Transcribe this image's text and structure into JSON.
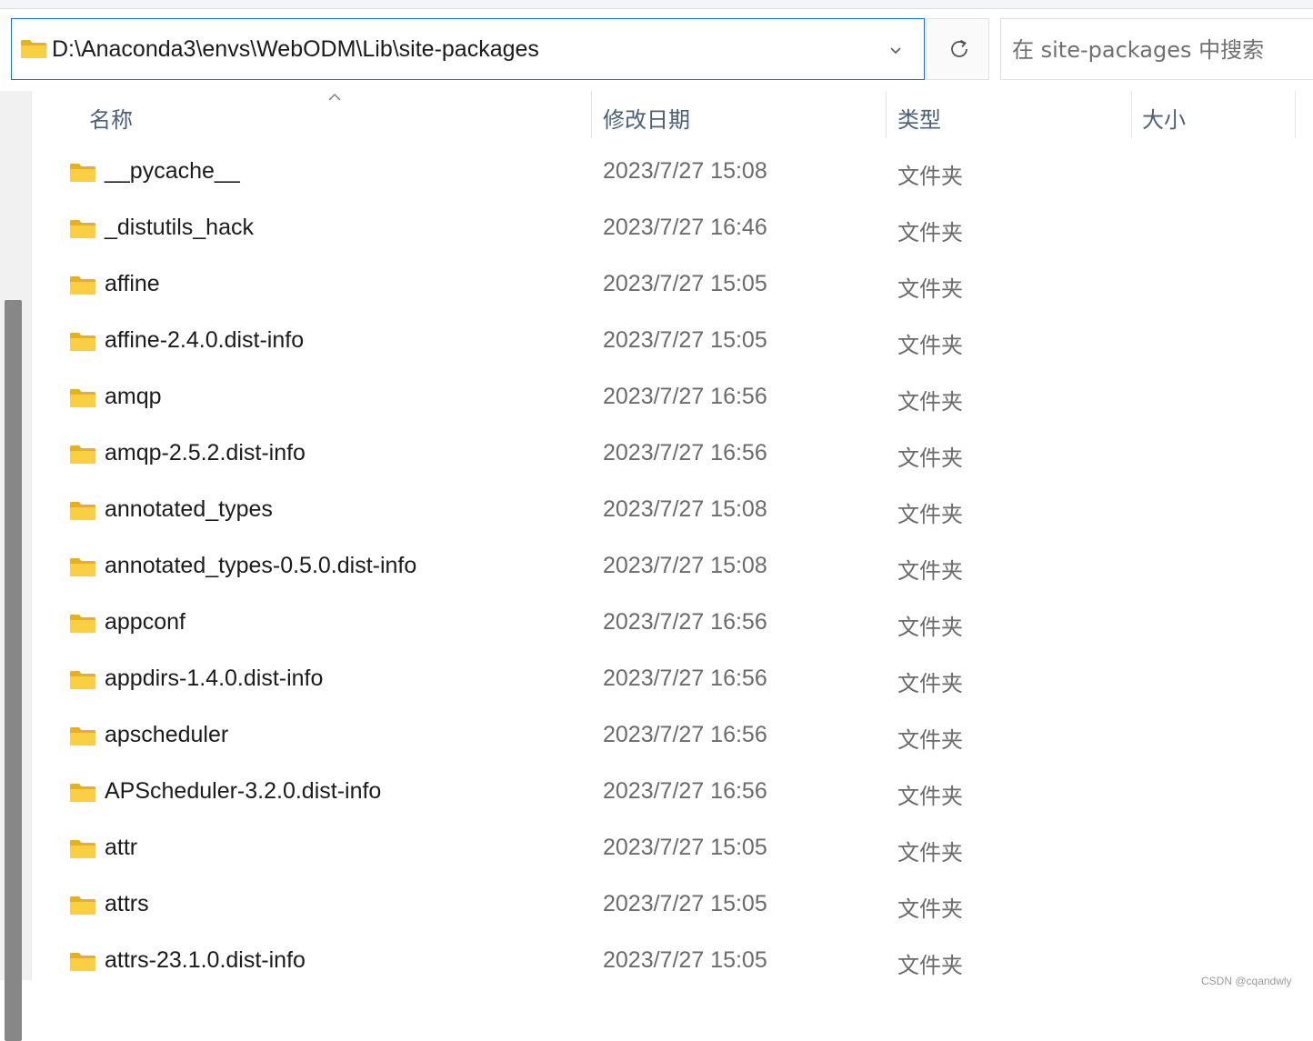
{
  "address_bar": {
    "path": "D:\\Anaconda3\\envs\\WebODM\\Lib\\site-packages"
  },
  "search": {
    "placeholder": "在 site-packages 中搜索"
  },
  "columns": {
    "name": "名称",
    "date": "修改日期",
    "type": "类型",
    "size": "大小"
  },
  "rows": [
    {
      "name": "__pycache__",
      "date": "2023/7/27 15:08",
      "type": "文件夹"
    },
    {
      "name": "_distutils_hack",
      "date": "2023/7/27 16:46",
      "type": "文件夹"
    },
    {
      "name": "affine",
      "date": "2023/7/27 15:05",
      "type": "文件夹"
    },
    {
      "name": "affine-2.4.0.dist-info",
      "date": "2023/7/27 15:05",
      "type": "文件夹"
    },
    {
      "name": "amqp",
      "date": "2023/7/27 16:56",
      "type": "文件夹"
    },
    {
      "name": "amqp-2.5.2.dist-info",
      "date": "2023/7/27 16:56",
      "type": "文件夹"
    },
    {
      "name": "annotated_types",
      "date": "2023/7/27 15:08",
      "type": "文件夹"
    },
    {
      "name": "annotated_types-0.5.0.dist-info",
      "date": "2023/7/27 15:08",
      "type": "文件夹"
    },
    {
      "name": "appconf",
      "date": "2023/7/27 16:56",
      "type": "文件夹"
    },
    {
      "name": "appdirs-1.4.0.dist-info",
      "date": "2023/7/27 16:56",
      "type": "文件夹"
    },
    {
      "name": "apscheduler",
      "date": "2023/7/27 16:56",
      "type": "文件夹"
    },
    {
      "name": "APScheduler-3.2.0.dist-info",
      "date": "2023/7/27 16:56",
      "type": "文件夹"
    },
    {
      "name": "attr",
      "date": "2023/7/27 15:05",
      "type": "文件夹"
    },
    {
      "name": "attrs",
      "date": "2023/7/27 15:05",
      "type": "文件夹"
    },
    {
      "name": "attrs-23.1.0.dist-info",
      "date": "2023/7/27 15:05",
      "type": "文件夹"
    }
  ],
  "watermark": "CSDN @cqandwly",
  "colors": {
    "accent": "#1f6fce",
    "folder": "#f8c93c",
    "header_text": "#4c607a"
  },
  "icons": {
    "address": "folder-icon",
    "dropdown": "chevron-down-icon",
    "refresh": "refresh-icon",
    "sort": "sort-ascending-icon",
    "row": "folder-icon"
  }
}
